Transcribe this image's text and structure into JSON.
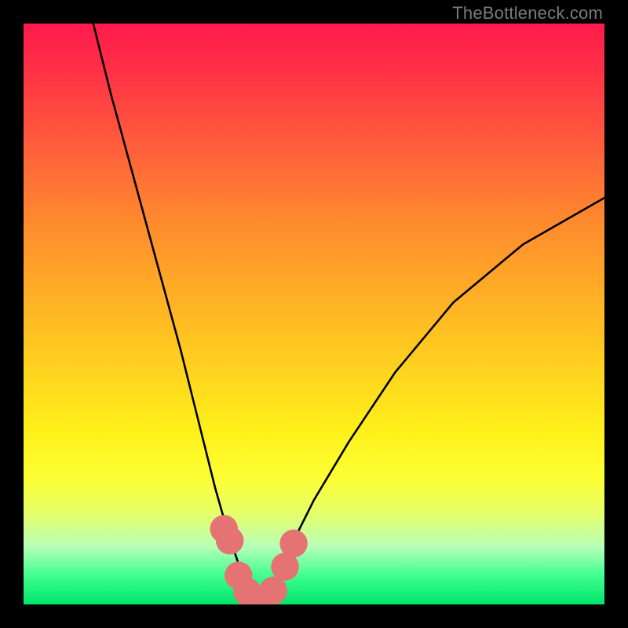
{
  "watermark": "TheBottleneck.com",
  "chart_data": {
    "type": "line",
    "title": "",
    "xlabel": "",
    "ylabel": "",
    "x_range": [
      0,
      100
    ],
    "y_range": [
      0,
      100
    ],
    "series": [
      {
        "name": "bottleneck-curve",
        "x": [
          12,
          15,
          18,
          21,
          24,
          27,
          29,
          31,
          33,
          35,
          37,
          39,
          40.5,
          42,
          44,
          46,
          50,
          56,
          64,
          74,
          86,
          100
        ],
        "y": [
          100,
          88,
          77,
          66,
          55,
          44,
          36,
          28,
          20,
          13,
          7,
          3,
          1.2,
          2,
          5,
          10,
          18,
          28,
          40,
          52,
          62,
          70
        ]
      }
    ],
    "markers": {
      "name": "highlight-points",
      "color": "#e57373",
      "radius": 2.4,
      "points": [
        {
          "x": 34.5,
          "y": 13
        },
        {
          "x": 35.5,
          "y": 11
        },
        {
          "x": 37,
          "y": 5
        },
        {
          "x": 38.5,
          "y": 2.2
        },
        {
          "x": 40,
          "y": 1.1
        },
        {
          "x": 41.5,
          "y": 1.1
        },
        {
          "x": 43,
          "y": 2.4
        },
        {
          "x": 45,
          "y": 6.5
        },
        {
          "x": 46.5,
          "y": 10.5
        }
      ]
    },
    "minimum": {
      "x": 40.5,
      "y": 1.2
    }
  }
}
